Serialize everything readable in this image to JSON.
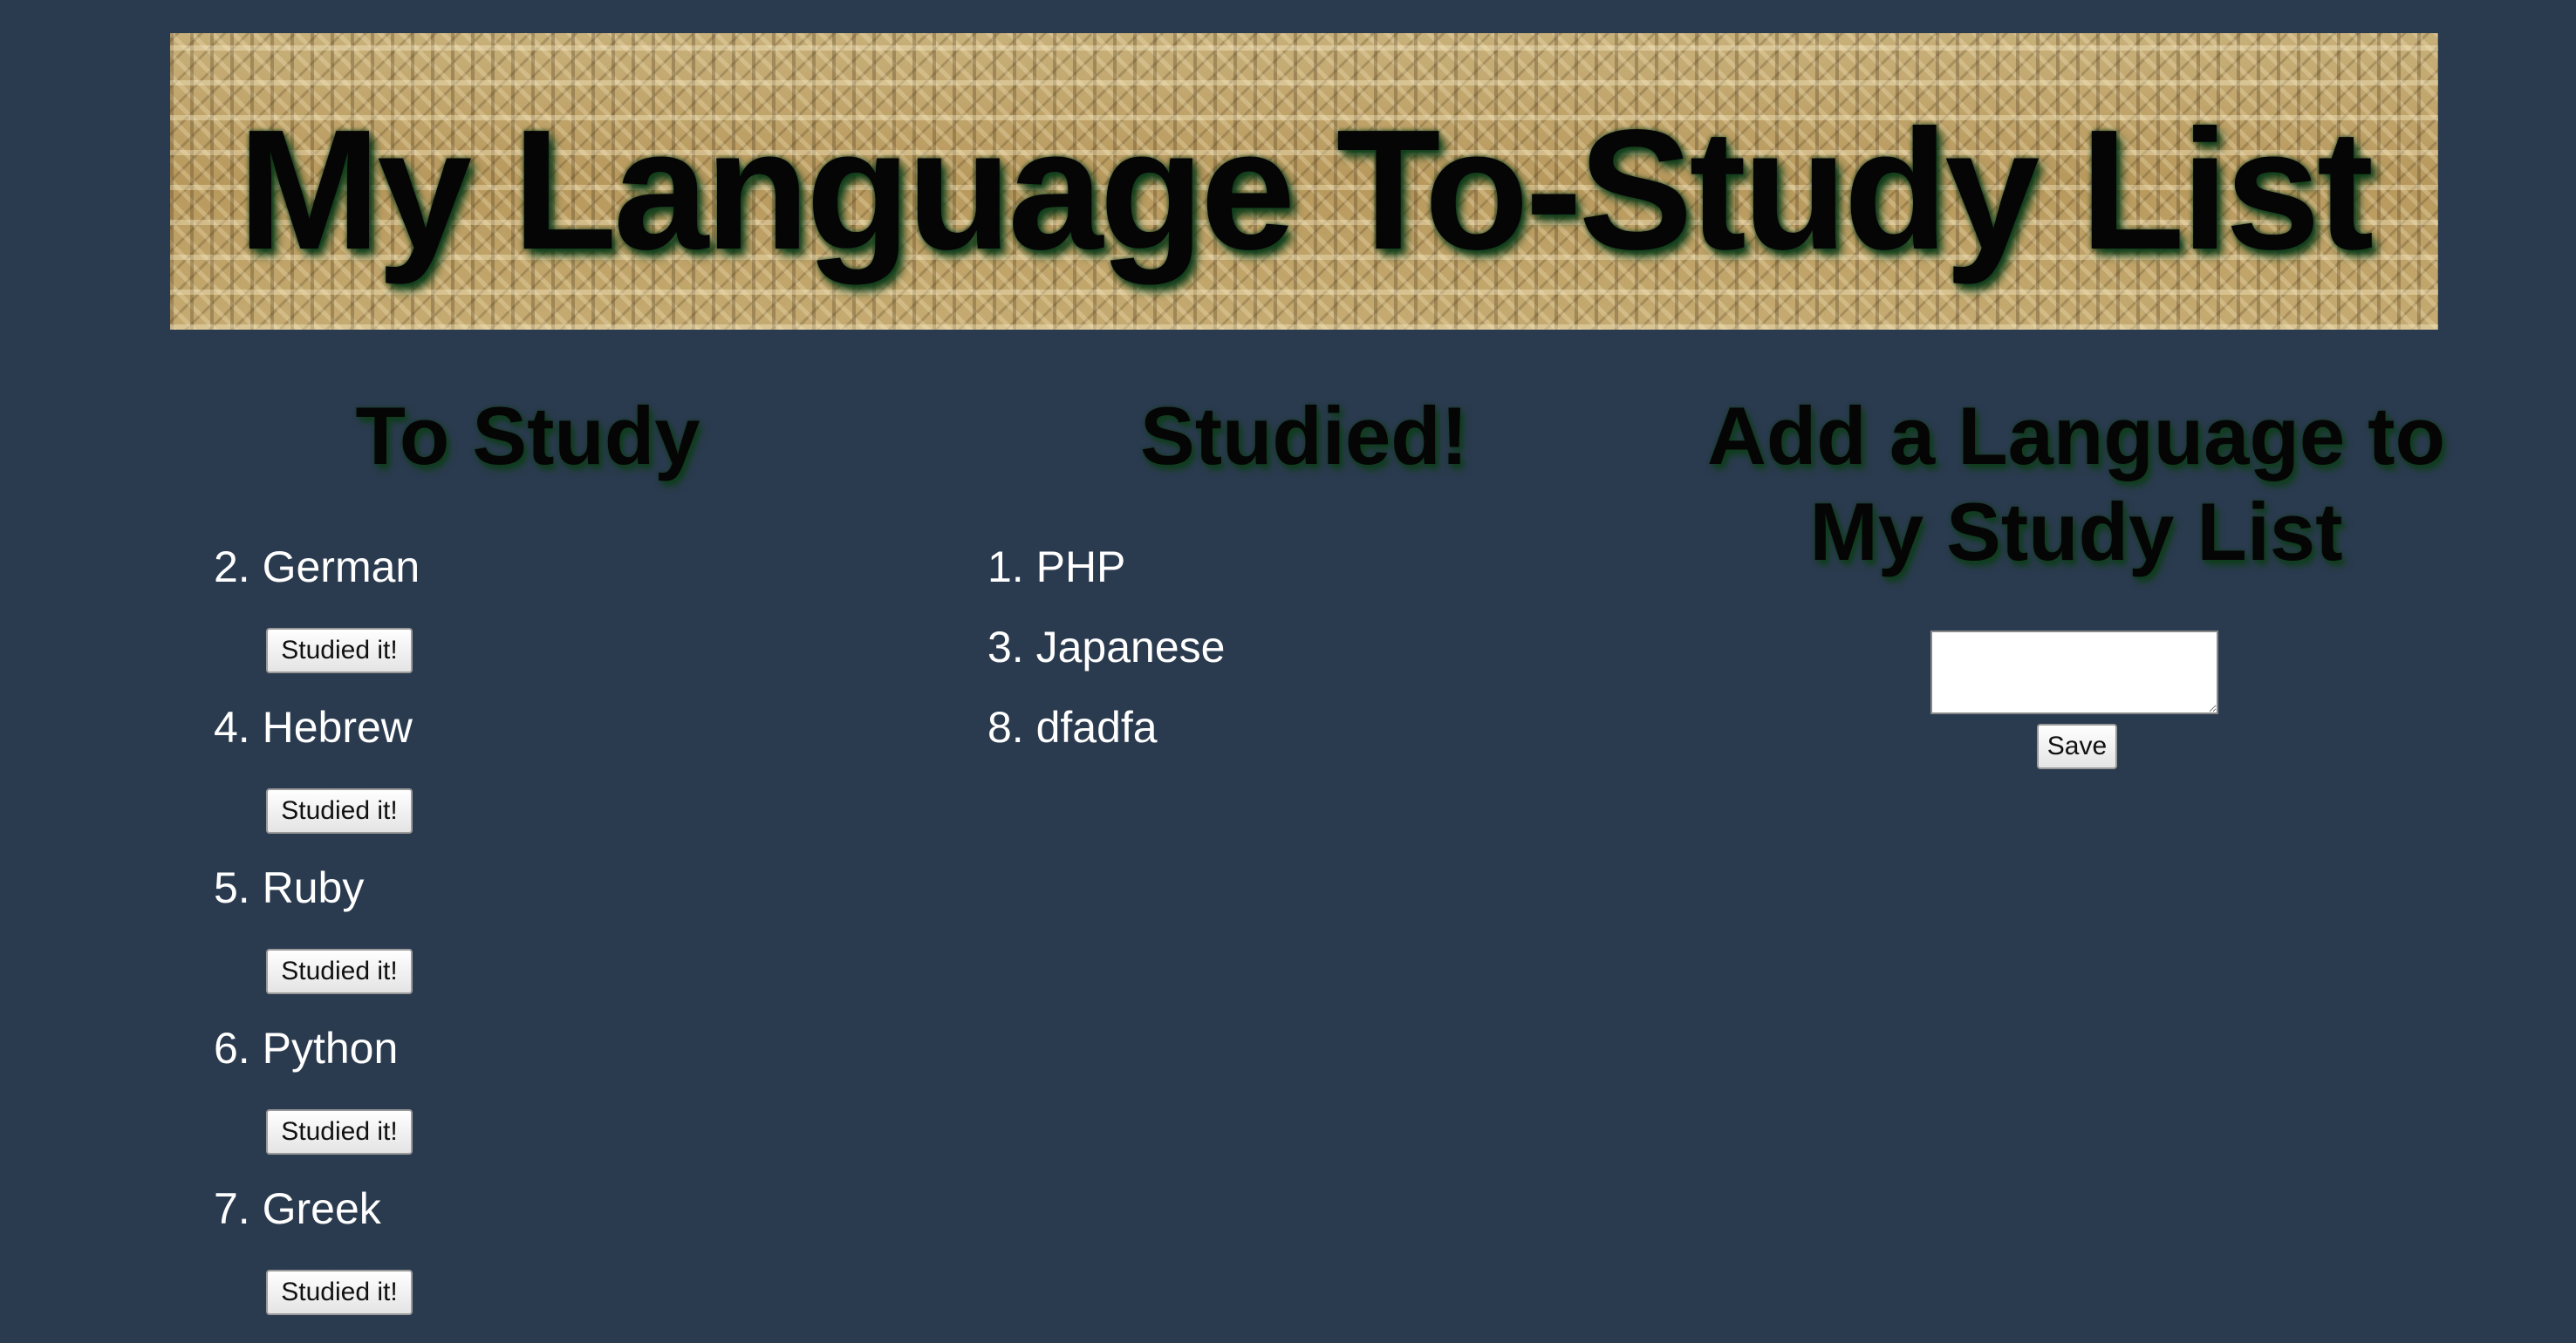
{
  "header": {
    "title": "My Language To-Study List"
  },
  "to_study": {
    "heading": "To Study",
    "items": [
      {
        "label": "2. German",
        "button": "Studied it!"
      },
      {
        "label": "4. Hebrew",
        "button": "Studied it!"
      },
      {
        "label": "5. Ruby",
        "button": "Studied it!"
      },
      {
        "label": "6. Python",
        "button": "Studied it!"
      },
      {
        "label": "7. Greek",
        "button": "Studied it!"
      }
    ]
  },
  "studied": {
    "heading": "Studied!",
    "items": [
      {
        "label": "1. PHP"
      },
      {
        "label": "3. Japanese"
      },
      {
        "label": "8. dfadfa"
      }
    ]
  },
  "add_form": {
    "heading": "Add a Language to My Study List",
    "input_value": "",
    "save_label": "Save"
  },
  "colors": {
    "background": "#2b3b4f",
    "heading_text": "#050505",
    "heading_glow": "#0e3d1a",
    "item_text": "#ffffff"
  }
}
